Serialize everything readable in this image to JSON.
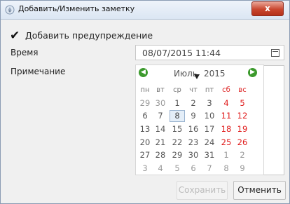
{
  "window": {
    "title": "Добавить/Изменить заметку",
    "close_label": "x"
  },
  "form": {
    "warning_label": "Добавить предупреждение",
    "time_label": "Время",
    "datetime_value": "08/07/2015 11:44",
    "note_label": "Примечание"
  },
  "calendar": {
    "month": "Июль",
    "year": "2015",
    "prev_icon": "chevron-left",
    "next_icon": "chevron-right",
    "weekdays": [
      "пн",
      "вт",
      "ср",
      "чт",
      "пт",
      "сб",
      "вс"
    ],
    "weeks": [
      [
        "29",
        "30",
        "1",
        "2",
        "3",
        "4",
        "5"
      ],
      [
        "6",
        "7",
        "8",
        "9",
        "10",
        "11",
        "12"
      ],
      [
        "13",
        "14",
        "15",
        "16",
        "17",
        "18",
        "19"
      ],
      [
        "20",
        "21",
        "22",
        "23",
        "24",
        "25",
        "26"
      ],
      [
        "27",
        "28",
        "29",
        "30",
        "31",
        "1",
        "2"
      ],
      [
        "3",
        "4",
        "5",
        "6",
        "7",
        "8",
        "9"
      ]
    ],
    "selected_day": "8",
    "weekend_color": "#e01a1a"
  },
  "buttons": {
    "save": "Сохранить",
    "cancel": "Отменить"
  }
}
